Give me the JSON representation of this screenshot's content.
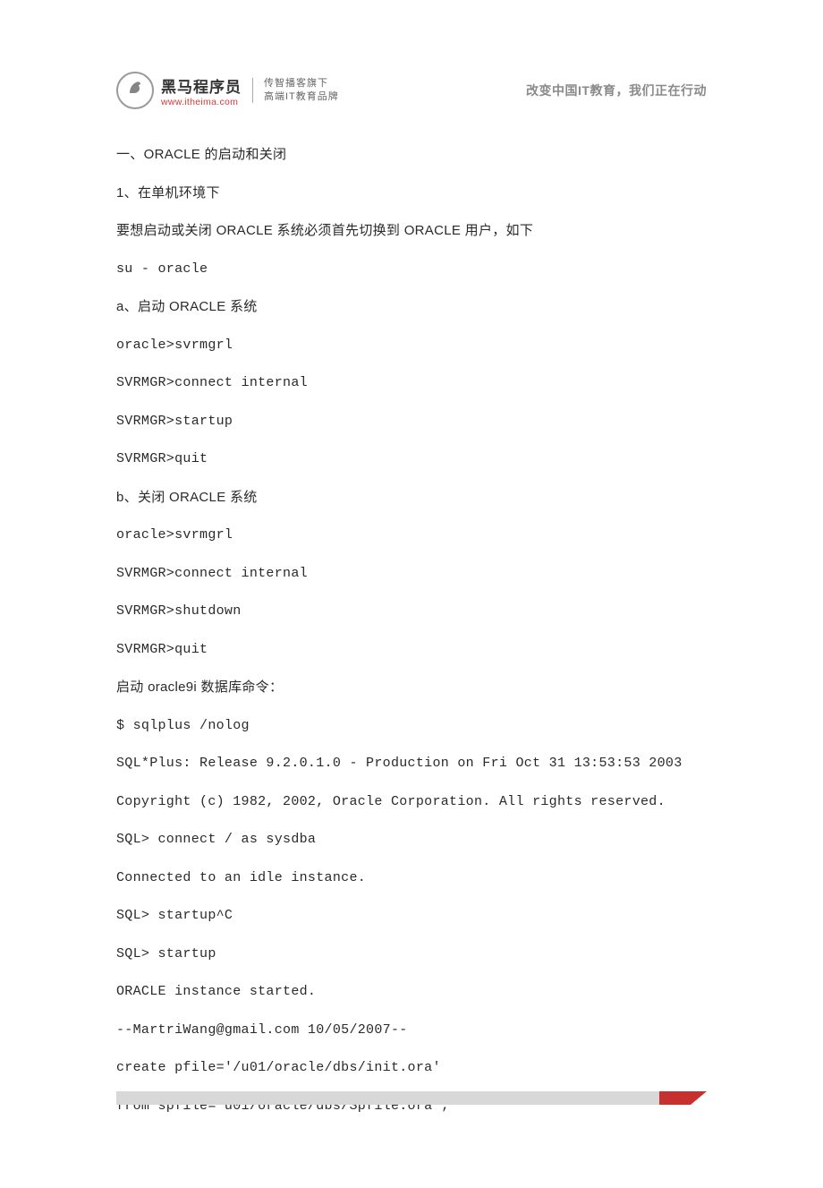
{
  "header": {
    "logo_title": "黑马程序员",
    "logo_url": "www.itheima.com",
    "logo_sub_line1": "传智播客旗下",
    "logo_sub_line2": "高端IT教育品牌",
    "slogan": "改变中国IT教育，我们正在行动"
  },
  "lines": {
    "l1": "一、ORACLE 的启动和关闭",
    "l2": "1、在单机环境下",
    "l3": "要想启动或关闭 ORACLE 系统必须首先切换到 ORACLE 用户，如下",
    "l4": "su - oracle",
    "l5": "a、启动 ORACLE 系统",
    "l6": "oracle>svrmgrl",
    "l7": "SVRMGR>connect internal",
    "l8": "SVRMGR>startup",
    "l9": "SVRMGR>quit",
    "l10": "b、关闭 ORACLE 系统",
    "l11": "oracle>svrmgrl",
    "l12": "SVRMGR>connect internal",
    "l13": "SVRMGR>shutdown",
    "l14": "SVRMGR>quit",
    "l15": "启动 oracle9i 数据库命令：",
    "l16": "$ sqlplus /nolog",
    "l17": "SQL*Plus: Release 9.2.0.1.0 - Production on Fri Oct 31 13:53:53 2003",
    "l18": "Copyright (c) 1982, 2002, Oracle Corporation.  All rights reserved.",
    "l19": "SQL> connect / as sysdba",
    "l20": "Connected to an idle instance.",
    "l21": "SQL> startup^C",
    "l22": "SQL> startup",
    "l23": "ORACLE instance started.",
    "l24": "--MartriWang@gmail.com  10/05/2007--",
    "l25": "create pfile='/u01/oracle/dbs/init.ora'",
    "l26": " from spfile='u01/oracle/dbs/Spfile.ora';"
  }
}
